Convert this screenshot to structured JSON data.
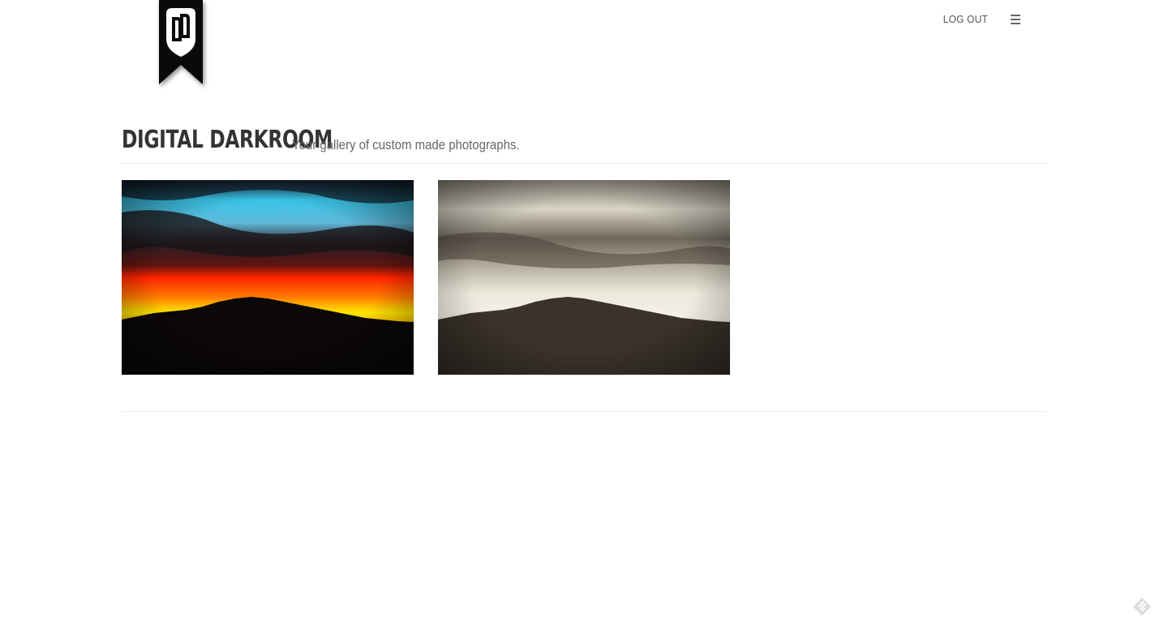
{
  "brand": {
    "logo_icon": "dd-ribbon-logo-icon"
  },
  "nav": {
    "logout_label": "LOG OUT",
    "menu_icon": "hamburger-menu-icon"
  },
  "header": {
    "title": "DIGITAL DARKROOM",
    "tagline": "Your gallery of custom made photographs."
  },
  "gallery": {
    "photos": [
      {
        "description_icon": "sunset-color-photo",
        "palette": [
          "#3cc4e6",
          "#ff2a00",
          "#ffe000",
          "#0b0807"
        ]
      },
      {
        "description_icon": "sunset-sepia-photo",
        "palette": [
          "#e8e4d8",
          "#6b6255",
          "#3a322b"
        ]
      }
    ]
  },
  "widgets": {
    "feedback_icon": "feedback-tag-icon"
  },
  "colors": {
    "text_dark": "#333333",
    "text_muted": "#666666",
    "rule": "#e8e8e8",
    "background": "#ffffff"
  }
}
